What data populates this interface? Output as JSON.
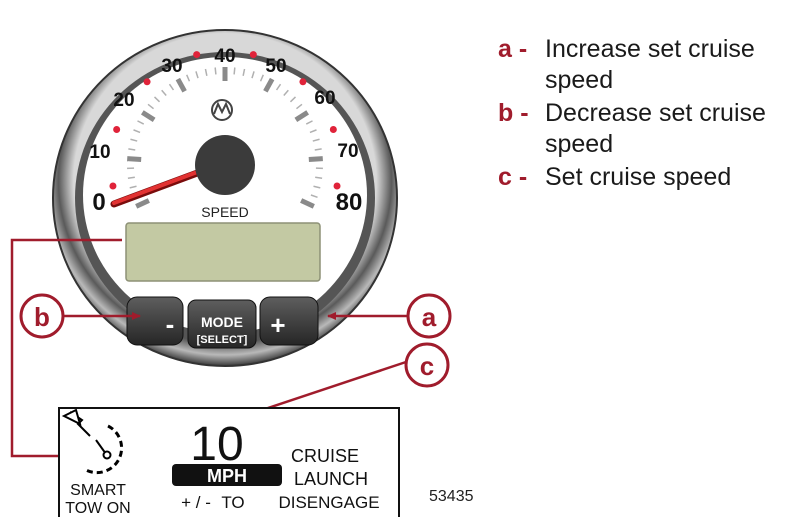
{
  "gauge": {
    "dial_numbers": [
      "0",
      "10",
      "20",
      "30",
      "40",
      "50",
      "60",
      "70",
      "80"
    ],
    "label": "SPEED",
    "logo_icon": "mercury-logo-icon",
    "buttons": {
      "minus": "-",
      "mode": "MODE",
      "select": "[SELECT]",
      "plus": "+"
    }
  },
  "callouts": {
    "a": "a",
    "b": "b",
    "c": "c"
  },
  "display": {
    "speed_value": "10",
    "unit": "MPH",
    "cruise": "CRUISE",
    "launch": "LAUNCH",
    "smart": "SMART",
    "tow_on": "TOW ON",
    "plus_minus": "+ / -",
    "to": "TO",
    "disengage": "DISENGAGE"
  },
  "legend": [
    {
      "key": "a -",
      "text": "Increase set cruise speed"
    },
    {
      "key": "b -",
      "text": "Decrease set cruise speed"
    },
    {
      "key": "c -",
      "text": "Set cruise speed"
    }
  ],
  "figure_number": "53435",
  "colors": {
    "callout_red": "#a01c2c",
    "lcd_green": "#c3c9a3",
    "bezel": "#8a8a8a",
    "needle": "#d42a2a"
  }
}
